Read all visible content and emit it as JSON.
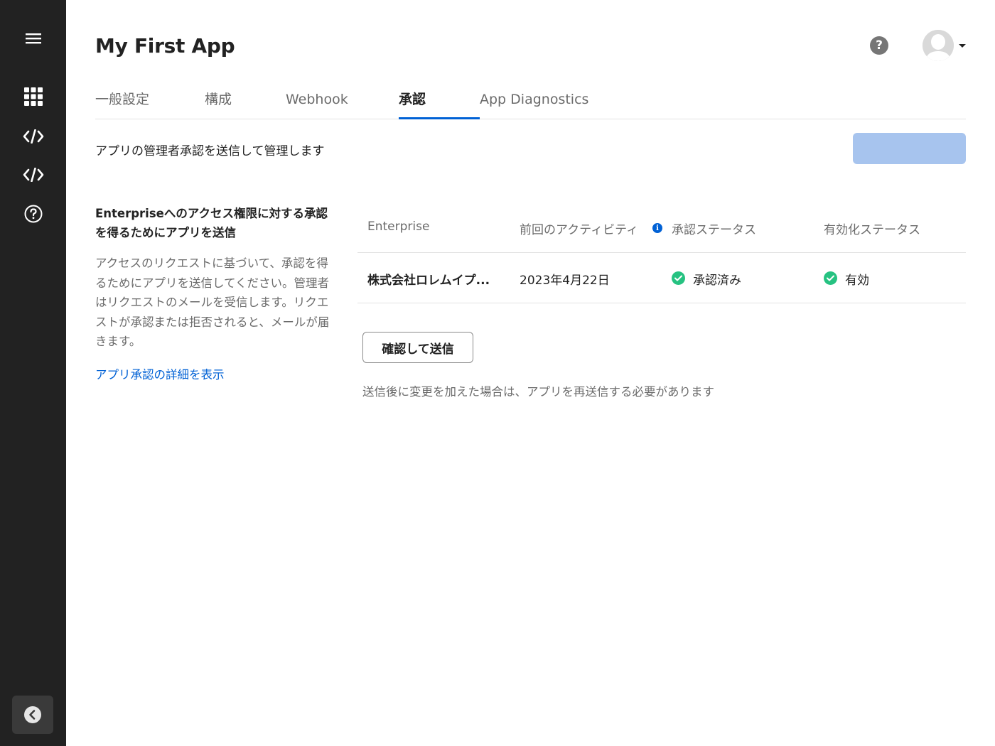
{
  "sidebar": {
    "items": [
      {
        "icon": "menu-icon"
      },
      {
        "icon": "apps-grid-icon"
      },
      {
        "icon": "code-icon"
      },
      {
        "icon": "code-icon"
      },
      {
        "icon": "help-circle-icon"
      }
    ],
    "collapse_icon": "chevron-left-icon"
  },
  "header": {
    "title": "My First App",
    "help_glyph": "?"
  },
  "tabs": [
    {
      "label": "一般設定"
    },
    {
      "label": "構成"
    },
    {
      "label": "Webhook"
    },
    {
      "label": "承認",
      "active": true
    },
    {
      "label": "App Diagnostics"
    }
  ],
  "page": {
    "subtitle": "アプリの管理者承認を送信して管理します"
  },
  "left": {
    "heading": "Enterpriseへのアクセス権限に対する承認を得るためにアプリを送信",
    "description": "アクセスのリクエストに基づいて、承認を得るためにアプリを送信してください。管理者はリクエストのメールを受信します。リクエストが承認または拒否されると、メールが届きます。",
    "link": "アプリ承認の詳細を表示"
  },
  "table": {
    "headers": [
      "Enterprise",
      "前回のアクティビティ",
      "承認ステータス",
      "有効化ステータス"
    ],
    "info_glyph": "i",
    "rows": [
      {
        "enterprise": "株式会社ロレムイプ...",
        "last_activity": "2023年4月22日",
        "approval_status": "承認済み",
        "activation_status": "有効"
      }
    ]
  },
  "actions": {
    "submit_label": "確認して送信",
    "note": "送信後に変更を加えた場合は、アプリを再送信する必要があります"
  },
  "colors": {
    "sidebar_bg": "#222222",
    "accent": "#0061d5",
    "success": "#26c281",
    "disabled_button": "#a7c4ee"
  }
}
